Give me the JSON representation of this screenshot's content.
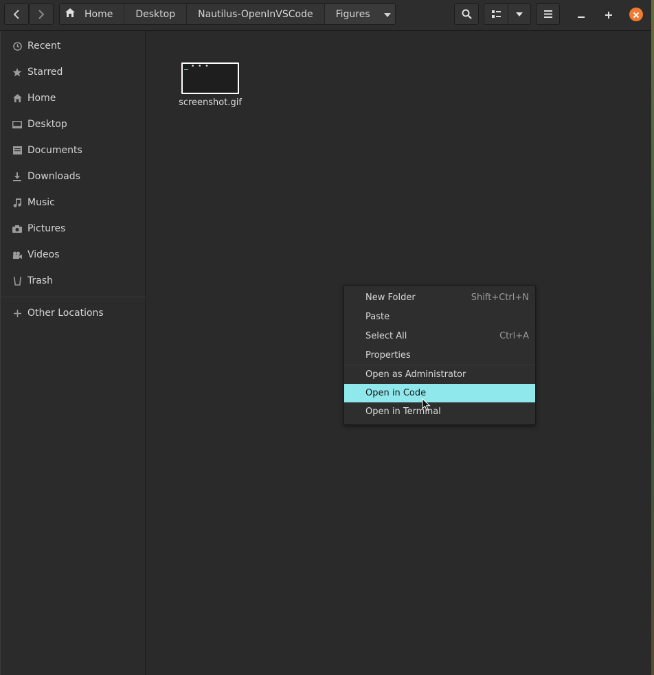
{
  "header": {
    "back_icon": "chevron-left-icon",
    "forward_icon": "chevron-right-icon",
    "breadcrumbs": [
      {
        "label": "Home",
        "icon": "home-icon"
      },
      {
        "label": "Desktop"
      },
      {
        "label": "Nautilus-OpenInVSCode"
      },
      {
        "label": "Figures",
        "current": true
      }
    ],
    "search_icon": "search-icon",
    "view_icon": "list-view-icon",
    "view_options_icon": "triangle-down-icon",
    "menu_icon": "hamburger-icon",
    "window_controls": [
      "minimize",
      "maximize",
      "close"
    ],
    "close_color": "#f07a30"
  },
  "sidebar": {
    "items": [
      {
        "label": "Recent",
        "icon": "clock-icon"
      },
      {
        "label": "Starred",
        "icon": "star-icon"
      },
      {
        "label": "Home",
        "icon": "home-icon"
      },
      {
        "label": "Desktop",
        "icon": "desktop-icon"
      },
      {
        "label": "Documents",
        "icon": "document-icon"
      },
      {
        "label": "Downloads",
        "icon": "download-icon"
      },
      {
        "label": "Music",
        "icon": "music-icon"
      },
      {
        "label": "Pictures",
        "icon": "camera-icon"
      },
      {
        "label": "Videos",
        "icon": "video-icon"
      },
      {
        "label": "Trash",
        "icon": "trash-icon"
      }
    ],
    "other_locations": {
      "label": "Other Locations",
      "icon": "plus-icon"
    }
  },
  "files": [
    {
      "name": "screenshot.gif"
    }
  ],
  "context_menu": {
    "items": [
      {
        "label": "New Folder",
        "shortcut": "Shift+Ctrl+N"
      },
      {
        "label": "Paste",
        "shortcut": ""
      },
      {
        "label": "Select All",
        "shortcut": "Ctrl+A"
      },
      {
        "label": "Properties",
        "shortcut": ""
      },
      {
        "label": "Open as Administrator",
        "shortcut": ""
      },
      {
        "label": "Open in Code",
        "shortcut": "",
        "highlighted": true
      },
      {
        "label": "Open in Terminal",
        "shortcut": ""
      }
    ],
    "highlight_color": "#8fe8ec"
  }
}
